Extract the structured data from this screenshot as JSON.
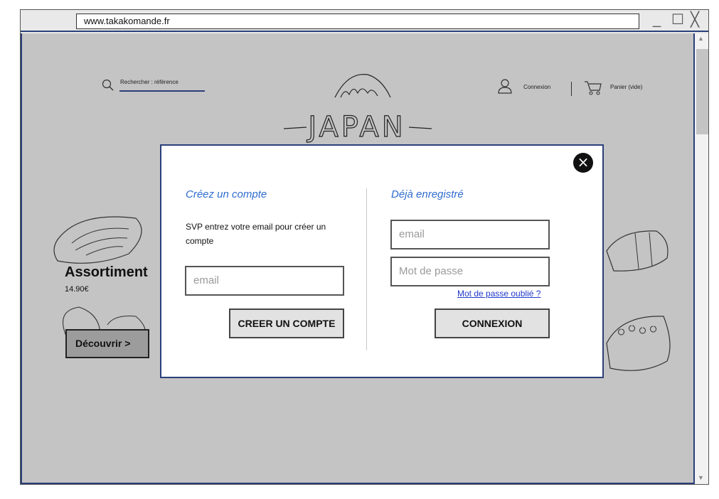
{
  "browser": {
    "url": "www.takakomande.fr",
    "controls": {
      "minimize": "_",
      "maximize": "☐",
      "close": "╳"
    }
  },
  "header": {
    "search_placeholder": "Rechercher : référence",
    "logo_text": "JAPAN",
    "login_label": "Connexion",
    "cart_label": "Panier (vide)"
  },
  "product": {
    "title": "Assortiment",
    "price": "14.90€",
    "discover_label": "Découvrir >"
  },
  "modal": {
    "close_icon": "×",
    "create": {
      "title": "Créez un compte",
      "description": "SVP entrez votre email pour créer un compte",
      "email_placeholder": "email",
      "button_label": "CREER UN COMPTE"
    },
    "login": {
      "title": "Déjà enregistré",
      "email_placeholder": "email",
      "password_placeholder": "Mot de passe",
      "forgot_label": "Mot de passe oublié ?",
      "button_label": "CONNEXION"
    }
  },
  "colors": {
    "accent_blue": "#2f6ccf",
    "border_navy": "#2b3f7a",
    "link": "#1f39c9",
    "backdrop": "#c4c4c4"
  }
}
